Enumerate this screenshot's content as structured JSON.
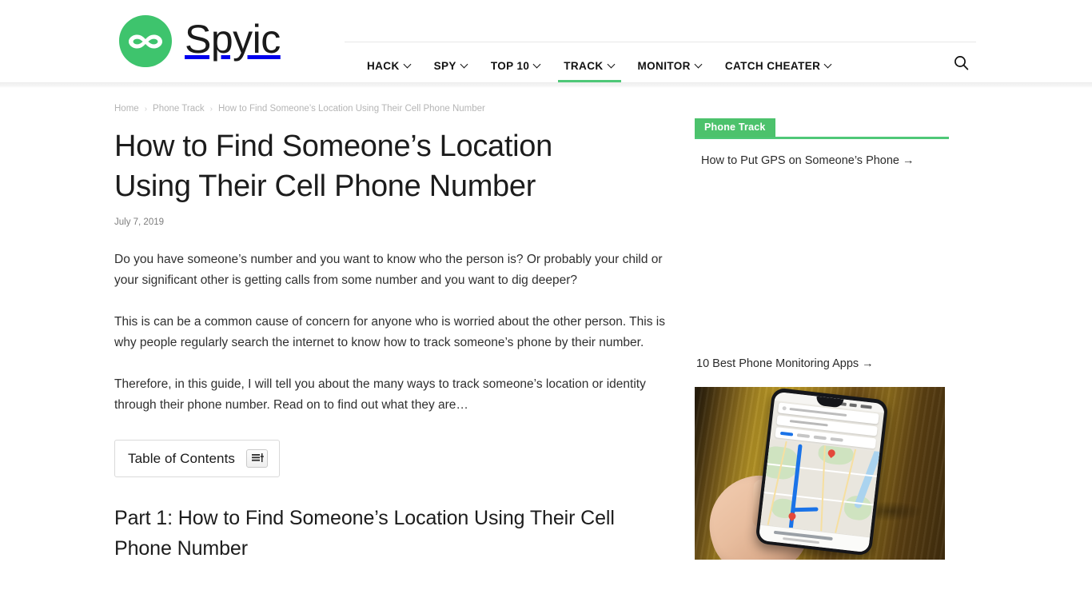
{
  "site": {
    "brand_name": "Spyic",
    "logo_icon": "infinity-mask-logo",
    "brand_green": "#3ec46d"
  },
  "nav": {
    "items": [
      {
        "label": "HACK",
        "has_dropdown": true,
        "active": false
      },
      {
        "label": "SPY",
        "has_dropdown": true,
        "active": false
      },
      {
        "label": "TOP 10",
        "has_dropdown": true,
        "active": false
      },
      {
        "label": "TRACK",
        "has_dropdown": true,
        "active": true
      },
      {
        "label": "MONITOR",
        "has_dropdown": true,
        "active": false
      },
      {
        "label": "CATCH CHEATER",
        "has_dropdown": true,
        "active": false
      }
    ],
    "search_icon": "search-icon",
    "active_underline_color": "#4fc878"
  },
  "breadcrumb": {
    "home": "Home",
    "category": "Phone Track",
    "current": "How to Find Someone’s Location Using Their Cell Phone Number",
    "separator": "›"
  },
  "article": {
    "title": "How to Find Someone’s Location Using Their Cell Phone Number",
    "date": "July 7, 2019",
    "paragraphs": [
      "Do you have someone’s number and you want to know who the person is? Or probably your child or your significant other is getting calls from some number and you want to dig deeper?",
      "This is can be a common cause of concern for anyone who is worried about the other person. This is why people regularly search the internet to know how to track someone’s phone by their number.",
      "Therefore, in this guide, I will tell you about the many ways to track someone’s location or identity through their phone number. Read on to find out what they are…"
    ],
    "toc_label": "Table of Contents",
    "toc_toggle_icon": "toc-list-toggle-icon",
    "section_heading": "Part 1: How to Find Someone’s Location Using Their Cell Phone Number"
  },
  "sidebar": {
    "widget_title": "Phone Track",
    "widget_accent": "#4cc26c",
    "links": [
      "How to Put GPS on Someone’s Phone →",
      "10 Best Phone Monitoring Apps →"
    ],
    "image_alt": "hand-holding-phone-with-map-navigation"
  }
}
